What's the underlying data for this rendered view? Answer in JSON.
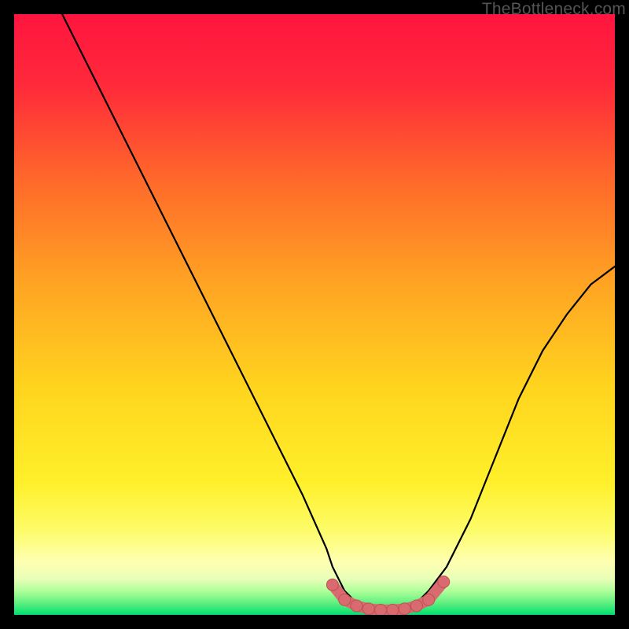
{
  "watermark": "TheBottleneck.com",
  "colors": {
    "gradient_top": "#ff1744",
    "gradient_upper_mid": "#ff5030",
    "gradient_mid": "#ffb020",
    "gradient_lower_mid": "#ffe020",
    "gradient_low": "#fff59d",
    "gradient_near_bottom": "#d0ff60",
    "gradient_bottom": "#00e676",
    "curve": "#000000",
    "marker_fill": "#d96a6f",
    "marker_stroke": "#c05050"
  },
  "chart_data": {
    "type": "line",
    "title": "",
    "xlabel": "",
    "ylabel": "",
    "xlim": [
      0,
      100
    ],
    "ylim": [
      0,
      100
    ],
    "series": [
      {
        "name": "bottleneck-curve",
        "x": [
          8,
          12,
          16,
          20,
          24,
          28,
          32,
          36,
          40,
          44,
          48,
          52,
          53,
          55,
          57,
          59,
          61,
          63,
          65,
          67,
          69,
          72,
          76,
          80,
          84,
          88,
          92,
          96,
          100
        ],
        "y": [
          100,
          92,
          84,
          76,
          68,
          60,
          52,
          44,
          36,
          28,
          20,
          11,
          8,
          4,
          2,
          1,
          0.5,
          0.5,
          1,
          2,
          4,
          8,
          16,
          26,
          36,
          44,
          50,
          55,
          58
        ]
      }
    ],
    "markers": {
      "name": "optimal-range",
      "x": [
        53,
        55,
        57,
        59,
        61,
        63,
        65,
        67,
        69,
        71.5
      ],
      "y": [
        5,
        2.5,
        1.5,
        1,
        0.8,
        0.8,
        1,
        1.5,
        2.5,
        5.5
      ]
    }
  }
}
